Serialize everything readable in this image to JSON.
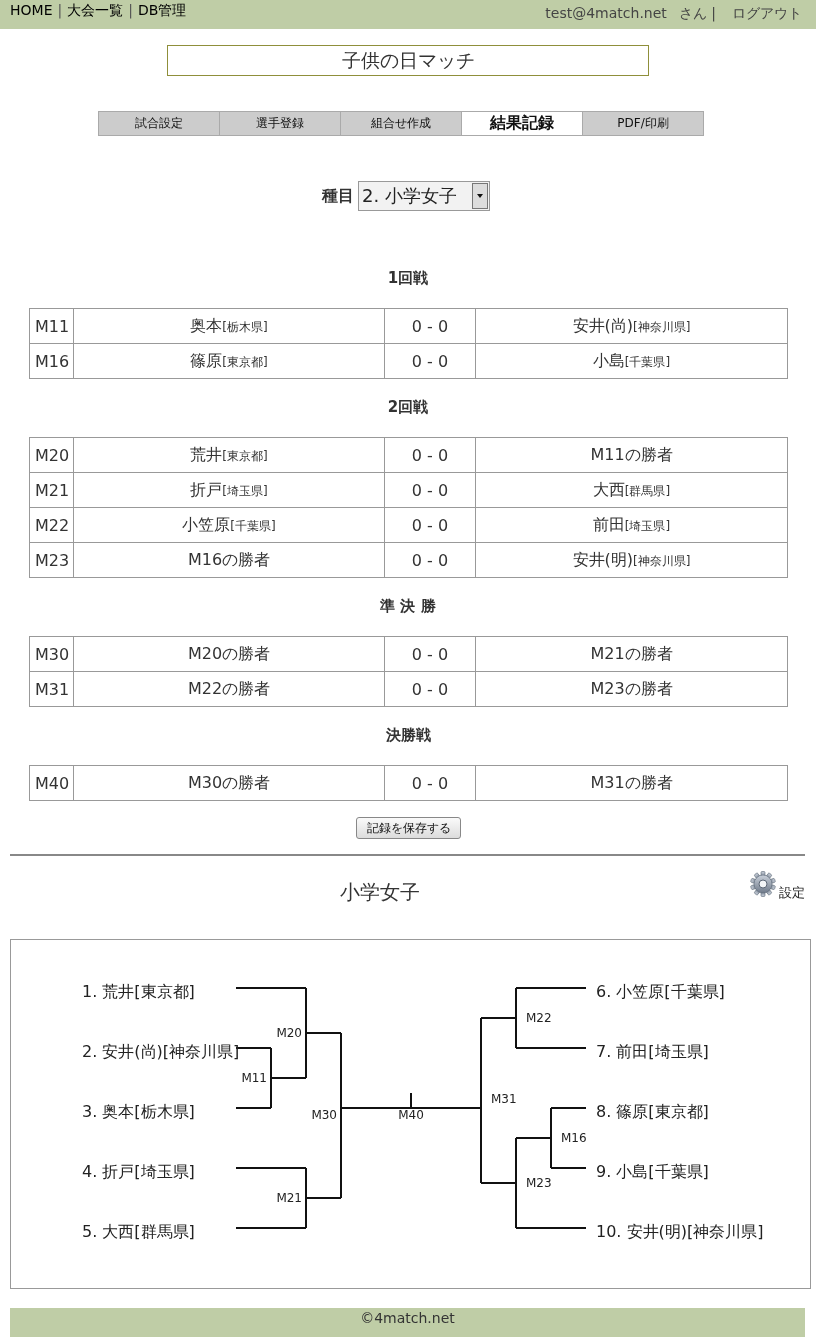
{
  "header": {
    "nav": [
      {
        "kind": "link",
        "text": "HOME"
      },
      {
        "kind": "separator",
        "text": "|"
      },
      {
        "kind": "link",
        "text": "大会一覧"
      },
      {
        "kind": "separator",
        "text": "|"
      },
      {
        "kind": "link",
        "text": "DB管理"
      }
    ],
    "user": "test@4match.net",
    "user_suffix": "さん |",
    "logout": "ログアウト"
  },
  "tournament_title": "子供の日マッチ",
  "tabs": [
    {
      "label": "試合設定",
      "selected": false
    },
    {
      "label": "選手登録",
      "selected": false
    },
    {
      "label": "組合せ作成",
      "selected": false
    },
    {
      "label": "結果記録",
      "selected": true
    },
    {
      "label": "PDF/印刷",
      "selected": false
    }
  ],
  "event_select": {
    "label": "種目",
    "value": "2. 小学女子"
  },
  "rounds": [
    {
      "title": "1回戦",
      "matches": [
        {
          "id": "M11",
          "player_1": {
            "name": "奥本",
            "affiliation": "[栃木県]"
          },
          "score": "0 - 0",
          "player_2": {
            "name": "安井(尚)",
            "affiliation": "[神奈川県]"
          }
        },
        {
          "id": "M16",
          "player_1": {
            "name": "篠原",
            "affiliation": "[東京都]"
          },
          "score": "0 - 0",
          "player_2": {
            "name": "小島",
            "affiliation": "[千葉県]"
          }
        }
      ]
    },
    {
      "title": "2回戦",
      "matches": [
        {
          "id": "M20",
          "player_1": {
            "name": "荒井",
            "affiliation": "[東京都]"
          },
          "score": "0 - 0",
          "player_2": {
            "name": "M11の勝者"
          }
        },
        {
          "id": "M21",
          "player_1": {
            "name": "折戸",
            "affiliation": "[埼玉県]"
          },
          "score": "0 - 0",
          "player_2": {
            "name": "大西",
            "affiliation": "[群馬県]"
          }
        },
        {
          "id": "M22",
          "player_1": {
            "name": "小笠原",
            "affiliation": "[千葉県]"
          },
          "score": "0 - 0",
          "player_2": {
            "name": "前田",
            "affiliation": "[埼玉県]"
          }
        },
        {
          "id": "M23",
          "player_1": {
            "name": "M16の勝者"
          },
          "score": "0 - 0",
          "player_2": {
            "name": "安井(明)",
            "affiliation": "[神奈川県]"
          }
        }
      ]
    },
    {
      "title": "準 決 勝",
      "matches": [
        {
          "id": "M30",
          "player_1": {
            "name": "M20の勝者"
          },
          "score": "0 - 0",
          "player_2": {
            "name": "M21の勝者"
          }
        },
        {
          "id": "M31",
          "player_1": {
            "name": "M22の勝者"
          },
          "score": "0 - 0",
          "player_2": {
            "name": "M23の勝者"
          }
        }
      ]
    },
    {
      "title": "決勝戦",
      "matches": [
        {
          "id": "M40",
          "player_1": {
            "name": "M30の勝者"
          },
          "score": "0 - 0",
          "player_2": {
            "name": "M31の勝者"
          }
        }
      ]
    }
  ],
  "save_button": "記録を保存する",
  "bracket_section": {
    "title": "小学女子",
    "settings_label": "設定",
    "final": {
      "kind": "match",
      "label": "M40",
      "children": [
        {
          "kind": "match",
          "label": "M30",
          "children": [
            {
              "kind": "match",
              "label": "M20",
              "children": [
                {
                  "kind": "entry",
                  "entry": "1. 荒井[東京都]"
                },
                {
                  "kind": "match",
                  "label": "M11",
                  "children": [
                    {
                      "kind": "entry",
                      "entry": "2. 安井(尚)[神奈川県]"
                    },
                    {
                      "kind": "entry",
                      "entry": "3. 奥本[栃木県]"
                    }
                  ]
                }
              ]
            },
            {
              "kind": "match",
              "label": "M21",
              "children": [
                {
                  "kind": "entry",
                  "entry": "4. 折戸[埼玉県]"
                },
                {
                  "kind": "entry",
                  "entry": "5. 大西[群馬県]"
                }
              ]
            }
          ]
        },
        {
          "kind": "match",
          "label": "M31",
          "children": [
            {
              "kind": "match",
              "label": "M22",
              "children": [
                {
                  "kind": "entry",
                  "entry": "6. 小笠原[千葉県]"
                },
                {
                  "kind": "entry",
                  "entry": "7. 前田[埼玉県]"
                }
              ]
            },
            {
              "kind": "match",
              "label": "M23",
              "children": [
                {
                  "kind": "match",
                  "label": "M16",
                  "children": [
                    {
                      "kind": "entry",
                      "entry": "8. 篠原[東京都]"
                    },
                    {
                      "kind": "entry",
                      "entry": "9. 小島[千葉県]"
                    }
                  ]
                },
                {
                  "kind": "entry",
                  "entry": "10. 安井(明)[神奈川県]"
                }
              ]
            }
          ]
        }
      ]
    }
  },
  "footer": "©4match.net"
}
